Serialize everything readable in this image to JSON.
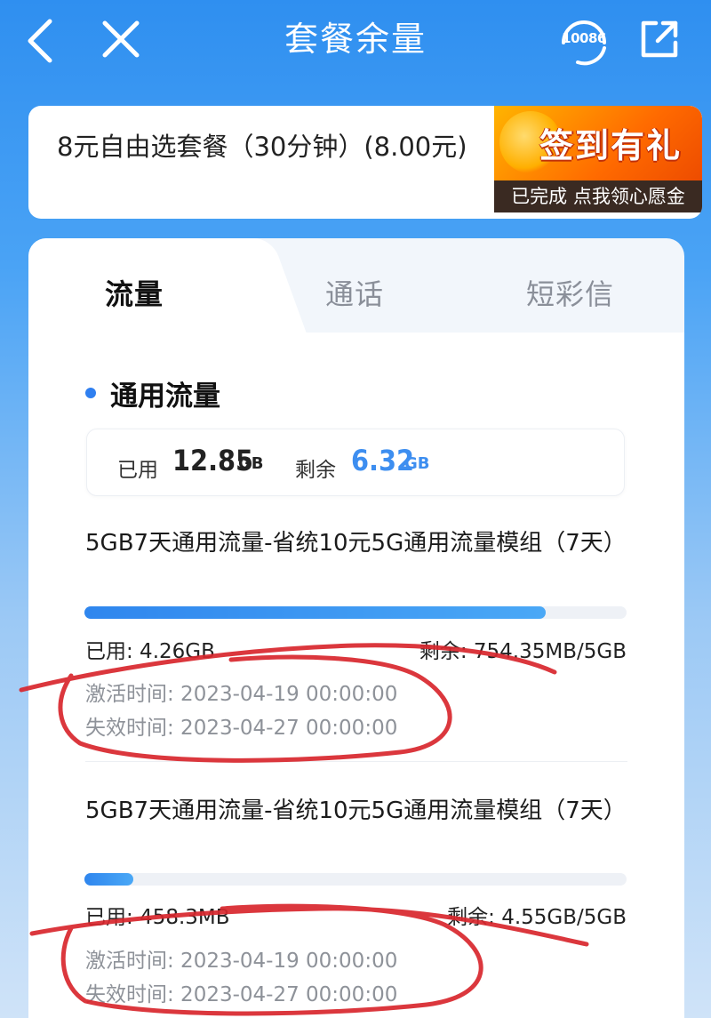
{
  "header": {
    "title": "套餐余量",
    "service_number": "10086",
    "back_icon": "chevron-left-icon",
    "close_icon": "close-icon",
    "service_icon": "headset-icon",
    "share_icon": "share-icon"
  },
  "plan": {
    "name": "8元自由选套餐（30分钟）(8.00元)",
    "checkin_title": "签到有礼",
    "checkin_sub": "已完成 点我领心愿金"
  },
  "tabs": [
    {
      "label": "流量",
      "active": true
    },
    {
      "label": "通话",
      "active": false
    },
    {
      "label": "短彩信",
      "active": false
    }
  ],
  "section": {
    "title": "通用流量",
    "used_label": "已用",
    "used_value": "12.85",
    "used_unit": "GB",
    "remain_label": "剩余",
    "remain_value": "6.32",
    "remain_unit": "GB"
  },
  "packages": [
    {
      "name": "5GB7天通用流量-省统10元5G通用流量模组（7天）",
      "progress": 0.85,
      "used": "已用: 4.26GB",
      "remain": "剩余: 754.35MB/5GB",
      "activate": "激活时间: 2023-04-19 00:00:00",
      "expire": "失效时间: 2023-04-27 00:00:00"
    },
    {
      "name": "5GB7天通用流量-省统10元5G通用流量模组（7天）",
      "progress": 0.09,
      "used": "已用: 458.3MB",
      "remain": "剩余: 4.55GB/5GB",
      "activate": "激活时间: 2023-04-19 00:00:00",
      "expire": "失效时间: 2023-04-27 00:00:00"
    }
  ],
  "colors": {
    "accent": "#2f86ee",
    "remain_value": "#3d8ef0",
    "annotation": "#d8262c"
  }
}
